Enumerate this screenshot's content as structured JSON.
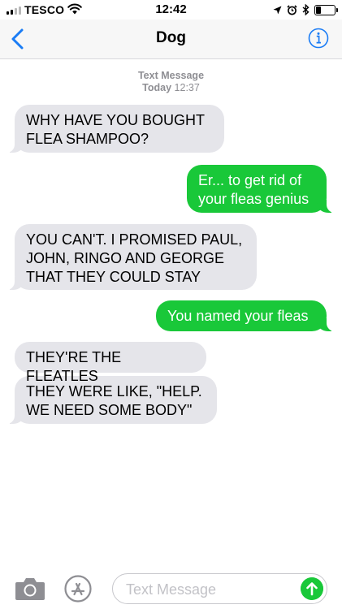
{
  "status_bar": {
    "carrier": "TESCO",
    "time": "12:42",
    "battery_level": 0.3
  },
  "nav": {
    "title": "Dog",
    "back_icon": "chevron-left-icon",
    "info_icon": "info-icon"
  },
  "conversation": {
    "service_label": "Text Message",
    "timestamp_day": "Today",
    "timestamp_time": "12:37",
    "messages": [
      {
        "from": "them",
        "text": "WHY HAVE YOU BOUGHT FLEA SHAMPOO?"
      },
      {
        "from": "me",
        "text": "Er... to get rid of your fleas genius"
      },
      {
        "from": "them",
        "text": "YOU CAN'T. I PROMISED PAUL, JOHN, RINGO AND GEORGE THAT THEY COULD STAY"
      },
      {
        "from": "me",
        "text": "You named your fleas"
      },
      {
        "from": "them",
        "text": "THEY'RE THE FLEATLES"
      },
      {
        "from": "them",
        "text": "THEY WERE LIKE, \"HELP. WE NEED SOME BODY\""
      }
    ]
  },
  "input_bar": {
    "placeholder": "Text Message",
    "camera_icon": "camera-icon",
    "apps_icon": "app-store-icon",
    "send_icon": "send-arrow-icon"
  },
  "colors": {
    "sent_bubble": "#19c839",
    "received_bubble": "#e5e5ea",
    "accent": "#1a7cf5"
  }
}
